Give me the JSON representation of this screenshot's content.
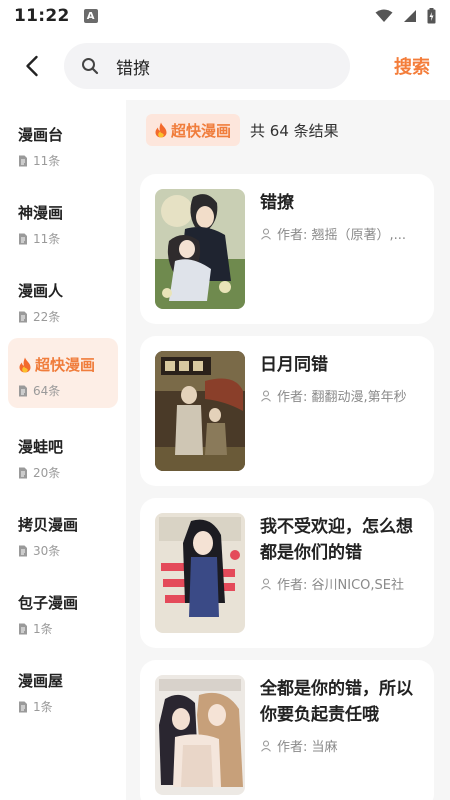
{
  "status_bar": {
    "time": "11:22",
    "notification_letter": "A"
  },
  "header": {
    "search_query": "错撩",
    "search_button": "搜索"
  },
  "sidebar": {
    "items": [
      {
        "name": "漫画台",
        "count": "11条",
        "active": false
      },
      {
        "name": "神漫画",
        "count": "11条",
        "active": false
      },
      {
        "name": "漫画人",
        "count": "22条",
        "active": false
      },
      {
        "name": "超快漫画",
        "count": "64条",
        "active": true
      },
      {
        "name": "漫蛙吧",
        "count": "20条",
        "active": false
      },
      {
        "name": "拷贝漫画",
        "count": "30条",
        "active": false
      },
      {
        "name": "包子漫画",
        "count": "1条",
        "active": false
      },
      {
        "name": "漫画屋",
        "count": "1条",
        "active": false
      }
    ]
  },
  "results": {
    "source_tag": "超快漫画",
    "count_text": "共 64 条结果",
    "items": [
      {
        "title": "错撩",
        "author": "作者: 翘摇（原著）,..."
      },
      {
        "title": "日月同错",
        "author": "作者: 翻翻动漫,第年秒"
      },
      {
        "title": "我不受欢迎，怎么想都是你们的错",
        "author": "作者: 谷川NICO,SE社"
      },
      {
        "title": "全都是你的错，所以你要负起责任哦",
        "author": "作者: 当麻"
      }
    ]
  },
  "colors": {
    "accent": "#f07d3c",
    "active_bg": "#fdeee6",
    "tag_bg": "#fde6dc"
  },
  "icons": {
    "back": "chevron-left-icon",
    "search": "search-icon",
    "fire": "fire-icon",
    "document": "document-icon",
    "person": "person-icon"
  }
}
